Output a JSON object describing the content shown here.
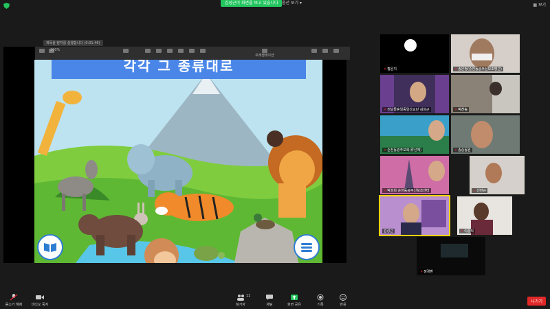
{
  "top": {
    "share_banner": "김성근이 화면을 보고 있습니다",
    "view_options": "옵션 보기",
    "view_button": "보기"
  },
  "share": {
    "label": "제목을 탐지를 실행합니다 (0:01:46)",
    "zoom": "100%",
    "present_label": "프레젠테이션"
  },
  "slide": {
    "title": "각각 그 종류대로"
  },
  "participants": [
    {
      "name": "황윤지",
      "muted": true
    },
    {
      "name": "송은정(순천동광주신보조명근)",
      "muted": true
    },
    {
      "name": "진날들휴일동일산교단 김성근",
      "muted": true
    },
    {
      "name": "박찬송",
      "muted": true
    },
    {
      "name": "순천동광주보회(류선예)",
      "muted": true
    },
    {
      "name": "송승동원",
      "muted": true
    },
    {
      "name": "박성희 순천동광주신보조센터",
      "muted": true
    },
    {
      "name": "신현규",
      "muted": true
    },
    {
      "name": "김성근",
      "muted": false,
      "active": true
    },
    {
      "name": "이종직",
      "muted": true
    },
    {
      "name": "정경환",
      "muted": true
    }
  ],
  "toolbar": {
    "unmute": "음소거 해제",
    "video": "비디오 중지",
    "participants": "참가자",
    "participant_count": "11",
    "chat": "채팅",
    "share": "화면 공유",
    "record": "기록",
    "reactions": "반응",
    "leave": "나가기"
  },
  "colors": {
    "share_green": "#22c55e",
    "leave_red": "#e02828",
    "active_speaker": "#f5d300",
    "slide_title_blue": "#4a86e8"
  }
}
